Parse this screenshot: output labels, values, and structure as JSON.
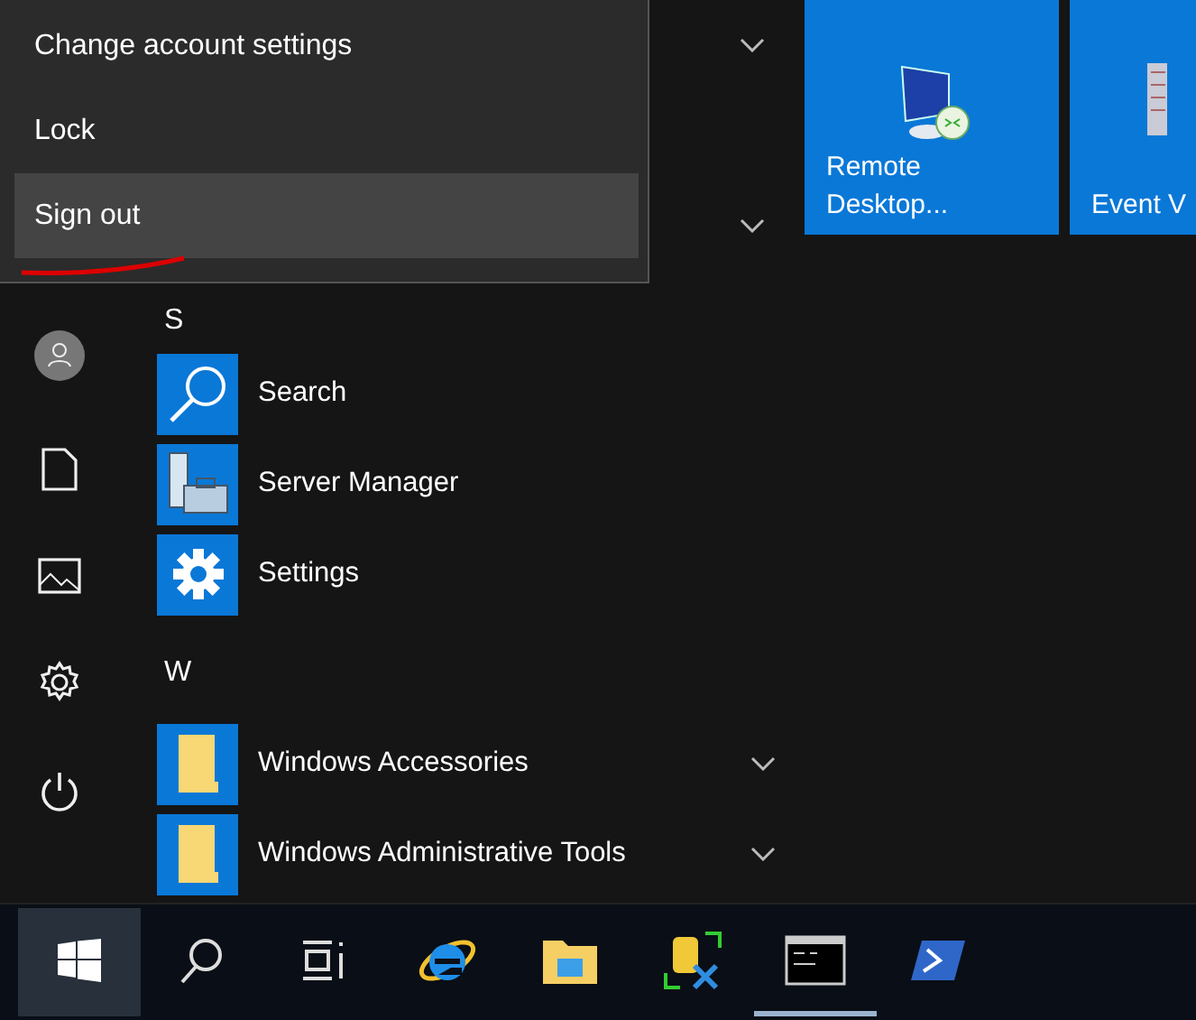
{
  "menu": {
    "items": [
      {
        "label": "Change account settings",
        "selected": false
      },
      {
        "label": "Lock",
        "selected": false
      },
      {
        "label": "Sign out",
        "selected": true
      }
    ]
  },
  "groups": [
    {
      "letter": "S",
      "apps": [
        {
          "label": "Search",
          "kind": "search",
          "expandable": false
        },
        {
          "label": "Server Manager",
          "kind": "server",
          "expandable": false
        },
        {
          "label": "Settings",
          "kind": "gear",
          "expandable": false
        }
      ]
    },
    {
      "letter": "W",
      "apps": [
        {
          "label": "Windows Accessories",
          "kind": "folder",
          "expandable": true
        },
        {
          "label": "Windows Administrative Tools",
          "kind": "folder",
          "expandable": true
        }
      ]
    }
  ],
  "tiles": [
    {
      "label": "Remote Desktop...",
      "kind": "remote"
    },
    {
      "label": "Event V",
      "kind": "event"
    }
  ],
  "taskbar": {
    "items": [
      {
        "kind": "start",
        "selected": true,
        "running": false
      },
      {
        "kind": "search",
        "selected": false,
        "running": false
      },
      {
        "kind": "taskview",
        "selected": false,
        "running": false
      },
      {
        "kind": "ie",
        "selected": false,
        "running": false
      },
      {
        "kind": "explorer",
        "selected": false,
        "running": false
      },
      {
        "kind": "tools",
        "selected": false,
        "running": false
      },
      {
        "kind": "cmd",
        "selected": false,
        "running": true
      },
      {
        "kind": "powershell",
        "selected": false,
        "running": false
      }
    ]
  }
}
